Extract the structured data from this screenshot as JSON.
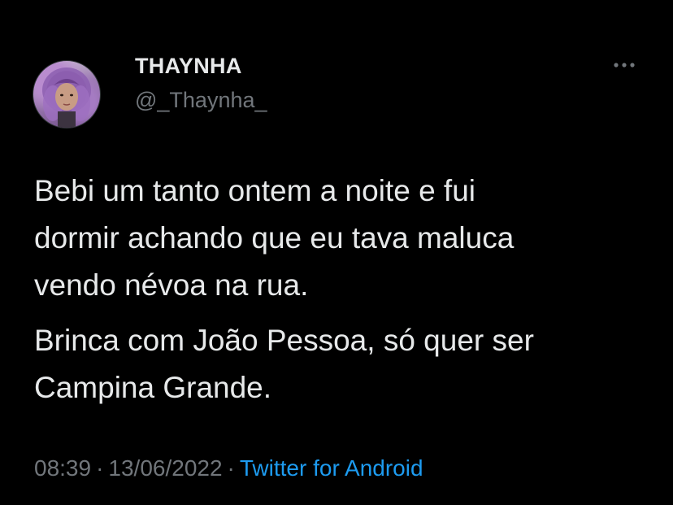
{
  "author": {
    "display_name": "THAYNHA",
    "handle": "@_Thaynha_",
    "avatar_icon": "profile-photo"
  },
  "more_menu": {
    "icon": "more-dots-icon"
  },
  "tweet": {
    "paragraphs": [
      "Bebi um tanto ontem a noite e fui\ndormir achando que eu tava maluca\nvendo névoa na rua.",
      "Brinca com João Pessoa, só quer ser\nCampina Grande."
    ]
  },
  "meta": {
    "time": "08:39",
    "separator": "·",
    "date": "13/06/2022",
    "source": "Twitter for Android"
  },
  "colors": {
    "background": "#000000",
    "text_primary": "#e7e9ea",
    "text_secondary": "#71767b",
    "link": "#1d9bf0"
  }
}
